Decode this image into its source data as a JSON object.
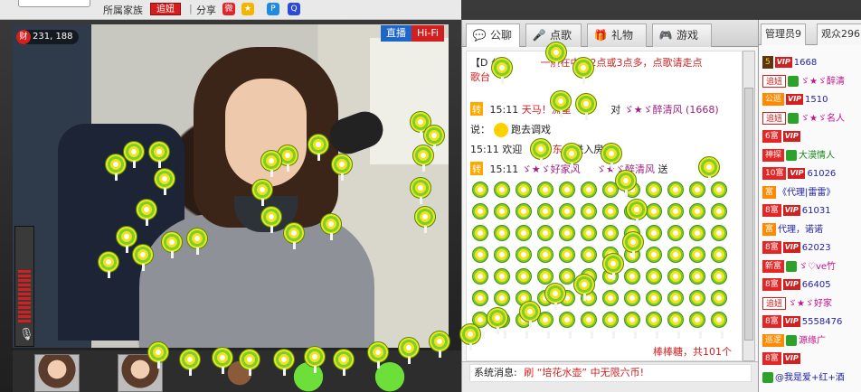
{
  "topbar": {
    "family_label": "所属家族",
    "follow_label": "追妞",
    "separator": "|",
    "share_label": "分享",
    "share_icons": [
      "weibo-icon",
      "qzone-icon",
      "p-icon",
      "qq-icon"
    ]
  },
  "video": {
    "wealth_icon_text": "财",
    "wealth_value": "231, 188",
    "badge_live": "直播",
    "badge_hifi": "Hi-Fi"
  },
  "chat": {
    "tabs": [
      {
        "label": "公聊",
        "icon": "chat-bubble-icon"
      },
      {
        "label": "点歌",
        "icon": "microphone-icon"
      },
      {
        "label": "礼物",
        "icon": "gift-icon"
      },
      {
        "label": "游戏",
        "icon": "gamepad-icon"
      }
    ],
    "lines": [
      {
        "prefix": "【D",
        "mid": "公",
        "text": "一般在中午2点或3点多，点歌请走点"
      },
      {
        "text": "歌台"
      },
      {
        "time": "15:11",
        "badge": "转",
        "user": "天马！流星",
        "target": "对",
        "to": "ゞ★ゞ醉清风 (1668)"
      },
      {
        "say": "说：",
        "text": "跑去调戏"
      },
      {
        "time": "15:11",
        "text": "欢迎",
        "user": "东",
        "rest": "” 进入房间"
      },
      {
        "time": "15:11",
        "badge": "转",
        "user": "ゞ★ゞ好家风",
        "to": "ゞ★ゞ醉清风",
        "action": "送"
      }
    ],
    "gift_summary": "棒棒糖，共101个",
    "system_label": "系统消息:",
    "system_text": "刷 “培花水壶” 中无限六币!"
  },
  "users": {
    "tab_admin": "管理员9",
    "tab_viewers": "观众296",
    "rows": [
      {
        "level": "5",
        "level_color": "brown",
        "vip": true,
        "name": "1668",
        "name_color": "blue"
      },
      {
        "level": "追妞",
        "level_color": "follow",
        "green": true,
        "name": "ゞ★ゞ醉清",
        "name_color": "pink"
      },
      {
        "level": "公巡",
        "level_color": "orange",
        "vip": true,
        "name": "1510",
        "name_color": "blue"
      },
      {
        "level": "追妞",
        "level_color": "follow",
        "green": true,
        "name": "ゞ★ゞ名人",
        "name_color": "pink"
      },
      {
        "level": "6富",
        "level_color": "red",
        "vip": true,
        "name": "",
        "name_color": "blue"
      },
      {
        "level": "神探",
        "level_color": "red",
        "green": true,
        "name": "大漠情人",
        "name_color": "green"
      },
      {
        "level": "10富",
        "level_color": "red",
        "vip": true,
        "name": "61026",
        "name_color": "blue"
      },
      {
        "level": "富",
        "level_color": "orange",
        "green": false,
        "name": "《代理|雷雷》",
        "name_color": "blue"
      },
      {
        "level": "8富",
        "level_color": "red",
        "vip": true,
        "name": "61031",
        "name_color": "blue"
      },
      {
        "level": "富",
        "level_color": "orange",
        "green": false,
        "name": "代理，诺诺",
        "name_color": "blue"
      },
      {
        "level": "8富",
        "level_color": "red",
        "vip": true,
        "name": "62023",
        "name_color": "blue"
      },
      {
        "level": "新富",
        "level_color": "red",
        "green": true,
        "name": "ゞ♡ve竹",
        "name_color": "pink"
      },
      {
        "level": "8富",
        "level_color": "red",
        "vip": true,
        "name": "66405",
        "name_color": "blue"
      },
      {
        "level": "追妞",
        "level_color": "follow",
        "green": false,
        "name": "ゞ★ゞ好家",
        "name_color": "pink"
      },
      {
        "level": "8富",
        "level_color": "red",
        "vip": true,
        "name": "5558476",
        "name_color": "blue"
      },
      {
        "level": "巡逻",
        "level_color": "orange",
        "green": true,
        "name": "源缘广",
        "name_color": "pink"
      },
      {
        "level": "8富",
        "level_color": "red",
        "vip": true,
        "name": "",
        "name_color": "blue"
      },
      {
        "level": "",
        "level_color": "orange",
        "green": true,
        "name": "@我是爱+红+酒",
        "name_color": "blue"
      }
    ]
  }
}
